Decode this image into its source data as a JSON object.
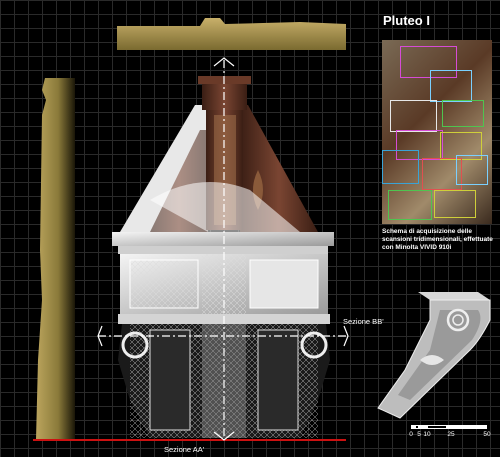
{
  "title": "Pluteo I",
  "caption_lines": [
    "Schema di acquisizione delle",
    "scansioni tridimensionali, effettuate",
    "con Minolta VIVID 910i"
  ],
  "section_bb_label": "Sezione BB'",
  "section_aa_label": "Sezione AA'",
  "scale": {
    "ticks": [
      "0",
      "5",
      "10",
      "25",
      "50"
    ]
  },
  "colors": {
    "profile_gold": "#b8a15a",
    "wood_dark": "#5a2f22",
    "baseline_red": "#cc1111",
    "grid": "#2a2a2a"
  }
}
